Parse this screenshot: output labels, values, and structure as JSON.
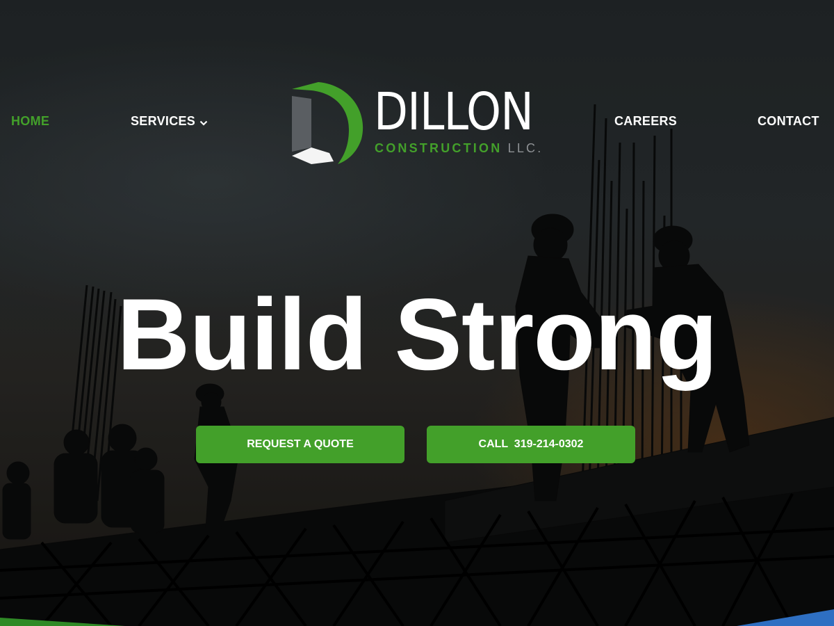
{
  "nav": {
    "home": "HOME",
    "services": "SERVICES",
    "careers": "CAREERS",
    "contact": "CONTACT"
  },
  "logo": {
    "name": "DILLON",
    "sub_green": "CONSTRUCTION",
    "sub_gray": "LLC."
  },
  "hero": {
    "headline": "Build Strong",
    "background": "construction workers silhouetted on building framework at dusk"
  },
  "cta": {
    "quote_label": "REQUEST A QUOTE",
    "call_label": "CALL  319-214-0302"
  },
  "colors": {
    "brand_green": "#43a02a",
    "text_white": "#ffffff",
    "accent_blue": "#2e6fc2",
    "logo_gray": "#8e9194"
  },
  "icons": {
    "services_dropdown": "chevron-down-icon"
  }
}
